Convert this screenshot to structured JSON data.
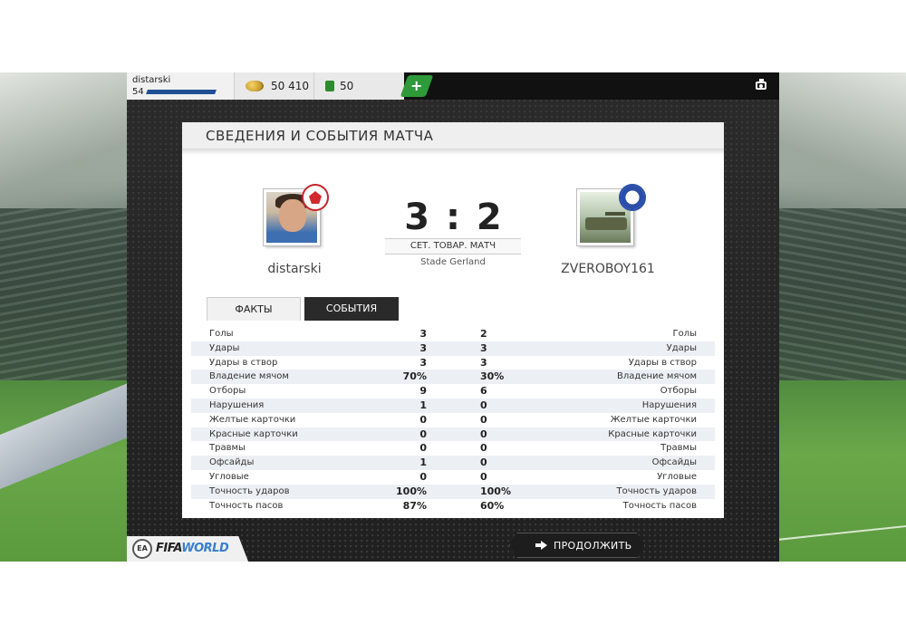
{
  "topbar": {
    "username": "distarski",
    "level": "54",
    "coins": "50 410",
    "points": "50",
    "add_label": "+"
  },
  "card": {
    "title": "СВЕДЕНИЯ И СОБЫТИЯ МАТЧА",
    "home_name": "distarski",
    "away_name": "ZVEROBOY161",
    "score": "3 : 2",
    "match_type": "СЕТ. ТОВАР. МАТЧ",
    "venue": "Stade Gerland",
    "tabs": [
      "ФАКТЫ",
      "СОБЫТИЯ"
    ]
  },
  "stats": [
    {
      "label": "Голы",
      "home": "3",
      "away": "2"
    },
    {
      "label": "Удары",
      "home": "3",
      "away": "3"
    },
    {
      "label": "Удары в створ",
      "home": "3",
      "away": "3"
    },
    {
      "label": "Владение мячом",
      "home": "70%",
      "away": "30%"
    },
    {
      "label": "Отборы",
      "home": "9",
      "away": "6"
    },
    {
      "label": "Нарушения",
      "home": "1",
      "away": "0"
    },
    {
      "label": "Желтые карточки",
      "home": "0",
      "away": "0"
    },
    {
      "label": "Красные карточки",
      "home": "0",
      "away": "0"
    },
    {
      "label": "Травмы",
      "home": "0",
      "away": "0"
    },
    {
      "label": "Офсайды",
      "home": "1",
      "away": "0"
    },
    {
      "label": "Угловые",
      "home": "0",
      "away": "0"
    },
    {
      "label": "Точность ударов",
      "home": "100%",
      "away": "100%"
    },
    {
      "label": "Точность пасов",
      "home": "87%",
      "away": "60%"
    }
  ],
  "footer": {
    "ea_label": "EA",
    "logo_fifa": "FIFA",
    "logo_world": "WORLD",
    "continue_label": "ПРОДОЛЖИТЬ"
  },
  "colors": {
    "level_bar": "#1f4f95",
    "add_button": "#2e9a3a",
    "tab_active_bg": "#f1f1f1",
    "tab_inactive_bg": "#2a2a2a"
  }
}
